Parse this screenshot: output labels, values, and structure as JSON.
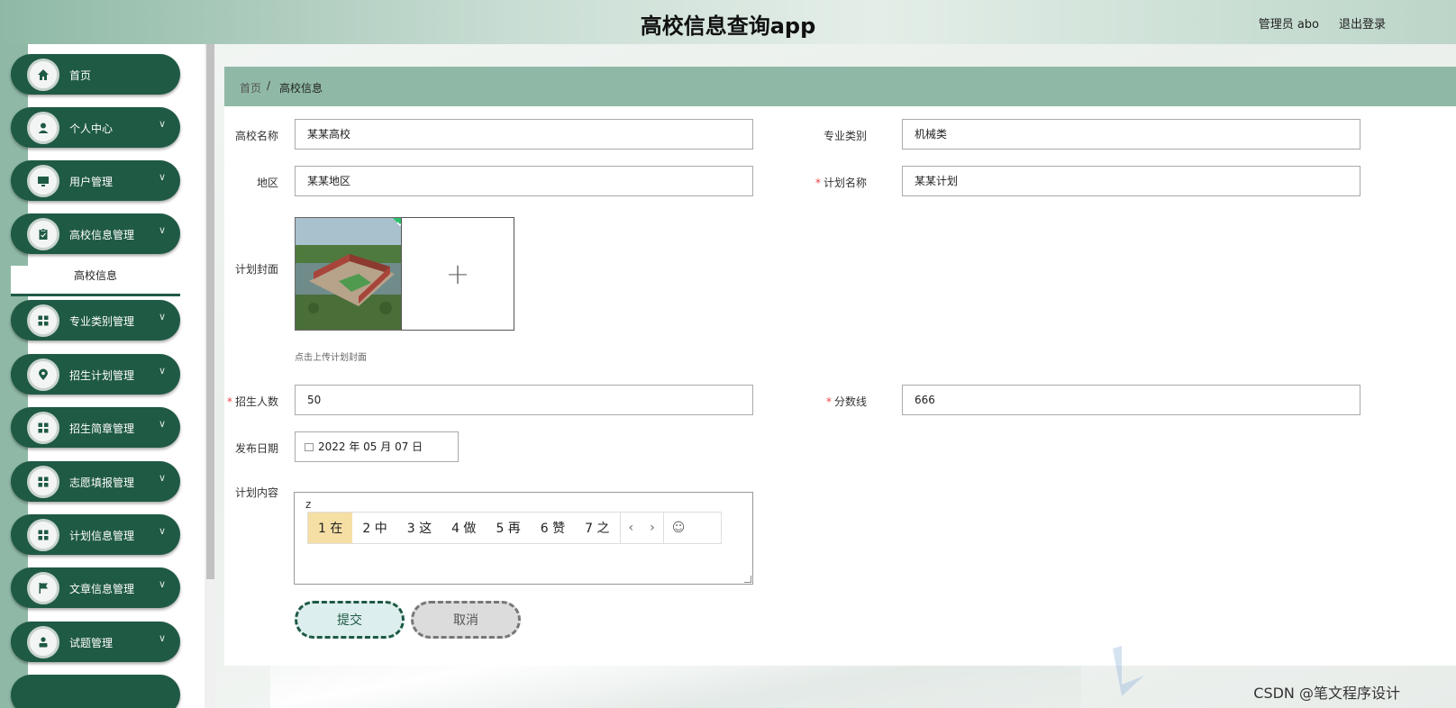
{
  "header": {
    "title": "高校信息查询app",
    "user": "管理员 abo",
    "logout": "退出登录"
  },
  "sidebar": {
    "items": [
      {
        "label": "首页",
        "icon": "home-icon",
        "has_arrow": false
      },
      {
        "label": "个人中心",
        "icon": "person-icon",
        "has_arrow": true
      },
      {
        "label": "用户管理",
        "icon": "monitor-icon",
        "has_arrow": true
      },
      {
        "label": "高校信息管理",
        "icon": "clipboard-icon",
        "has_arrow": true
      },
      {
        "label": "专业类别管理",
        "icon": "grid-icon",
        "has_arrow": true
      },
      {
        "label": "招生计划管理",
        "icon": "location-icon",
        "has_arrow": true
      },
      {
        "label": "招生简章管理",
        "icon": "grid-icon",
        "has_arrow": true
      },
      {
        "label": "志愿填报管理",
        "icon": "grid-icon",
        "has_arrow": true
      },
      {
        "label": "计划信息管理",
        "icon": "grid-icon",
        "has_arrow": true
      },
      {
        "label": "文章信息管理",
        "icon": "flag-icon",
        "has_arrow": true
      },
      {
        "label": "试题管理",
        "icon": "user-icon",
        "has_arrow": true
      }
    ],
    "active_sub": "高校信息"
  },
  "breadcrumb": {
    "home": "首页",
    "sep": "/",
    "current": "高校信息"
  },
  "form": {
    "school_name": {
      "label": "高校名称",
      "value": "某某高校"
    },
    "major_category": {
      "label": "专业类别",
      "value": "机械类"
    },
    "region": {
      "label": "地区",
      "value": "某某地区"
    },
    "plan_name": {
      "label": "计划名称",
      "value": "某某计划",
      "required": true
    },
    "cover": {
      "label": "计划封面",
      "hint": "点击上传计划封面"
    },
    "enroll_count": {
      "label": "招生人数",
      "value": "50",
      "required": true
    },
    "score_line": {
      "label": "分数线",
      "value": "666",
      "required": true
    },
    "publish_date": {
      "label": "发布日期",
      "value": "2022 年 05 月 07 日"
    },
    "content": {
      "label": "计划内容",
      "value": "z"
    }
  },
  "ime": {
    "candidates": [
      "1 在",
      "2 中",
      "3 这",
      "4 做",
      "5 再",
      "6 赞",
      "7 之"
    ],
    "prev": "‹",
    "next": "›",
    "emoji": "☺"
  },
  "buttons": {
    "submit": "提交",
    "cancel": "取消"
  },
  "watermark": "CSDN @笔文程序设计",
  "colors": {
    "primary": "#1f5a44",
    "accent": "#8fb9a6",
    "required": "#e44444"
  }
}
